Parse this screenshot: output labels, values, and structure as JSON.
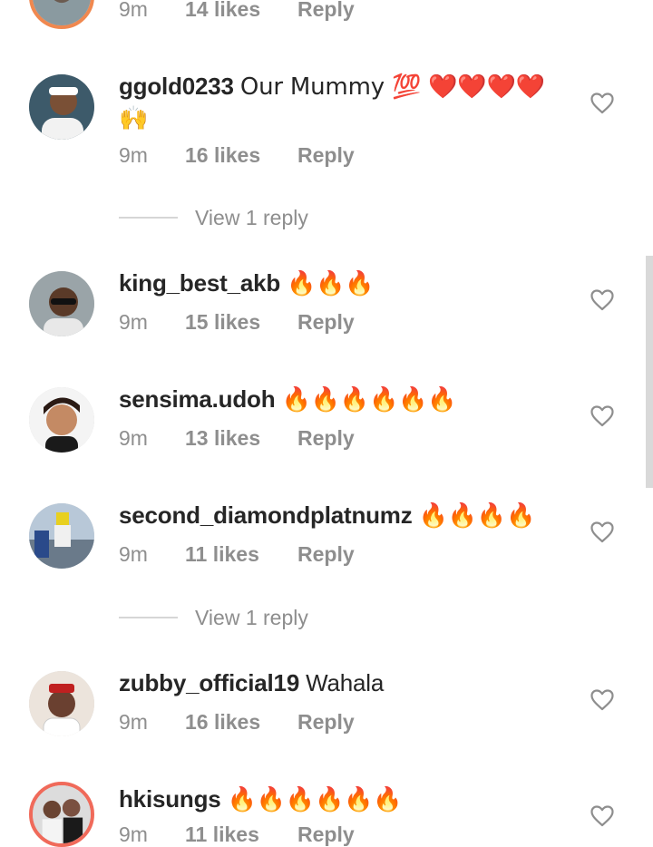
{
  "comments": [
    {
      "username": "",
      "text": "",
      "time": "9m",
      "likes": "14 likes",
      "reply": "Reply"
    },
    {
      "username": "ggold0233",
      "text": "Our Mummy 💯 ❤️❤️❤️❤️🙌",
      "time": "9m",
      "likes": "16 likes",
      "reply": "Reply"
    },
    {
      "username": "king_best_akb",
      "text": "🔥🔥🔥",
      "time": "9m",
      "likes": "15 likes",
      "reply": "Reply"
    },
    {
      "username": "sensima.udoh",
      "text": "🔥🔥🔥🔥🔥🔥",
      "time": "9m",
      "likes": "13 likes",
      "reply": "Reply"
    },
    {
      "username": "second_diamondplatnumz",
      "text": "🔥🔥🔥🔥",
      "time": "9m",
      "likes": "11 likes",
      "reply": "Reply"
    },
    {
      "username": "zubby_official19",
      "text": "Wahala",
      "time": "9m",
      "likes": "16 likes",
      "reply": "Reply"
    },
    {
      "username": "hkisungs",
      "text": "🔥🔥🔥🔥🔥🔥",
      "time": "9m",
      "likes": "11 likes",
      "reply": "Reply"
    }
  ],
  "view_replies": [
    "View 1 reply",
    "View 1 reply"
  ],
  "icons": {
    "like": "heart-outline-icon"
  },
  "colors": {
    "text": "#262626",
    "secondary": "#8e8e8e",
    "story_ring": "#f06a5a"
  }
}
